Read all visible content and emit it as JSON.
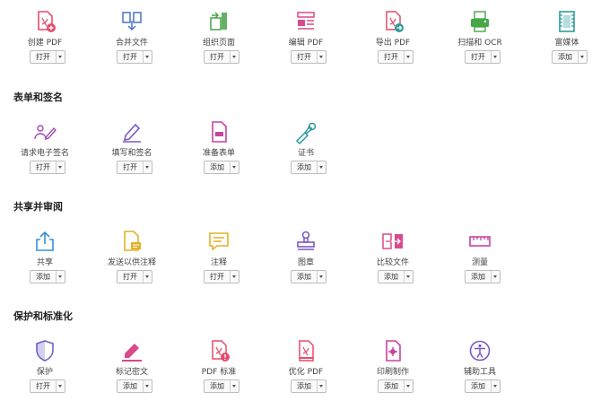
{
  "sections": {
    "forms_signatures": "表单和签名",
    "share_review": "共享并审阅",
    "protect_standardize": "保护和标准化"
  },
  "tools": {
    "create_pdf": {
      "label": "创建 PDF",
      "action": "打开",
      "color": "#e44d6a"
    },
    "combine_files": {
      "label": "合并文件",
      "action": "打开",
      "color": "#4a73c7"
    },
    "organize_pages": {
      "label": "组织页面",
      "action": "打开",
      "color": "#49a34a"
    },
    "edit_pdf": {
      "label": "编辑 PDF",
      "action": "打开",
      "color": "#d94a8c"
    },
    "export_pdf": {
      "label": "导出 PDF",
      "action": "打开",
      "color": "#2e9b9b"
    },
    "scan_ocr": {
      "label": "扫描和 OCR",
      "action": "打开",
      "color": "#45a845"
    },
    "rich_media": {
      "label": "富媒体",
      "action": "添加",
      "color": "#2e9b9b"
    },
    "request_signatures": {
      "label": "请求电子签名",
      "action": "打开",
      "color": "#a24db3"
    },
    "fill_sign": {
      "label": "填写和签名",
      "action": "打开",
      "color": "#7c58c4"
    },
    "prepare_form": {
      "label": "准备表单",
      "action": "添加",
      "color": "#c843a0"
    },
    "certificates": {
      "label": "证书",
      "action": "添加",
      "color": "#2e9b9b"
    },
    "share": {
      "label": "共享",
      "action": "添加",
      "color": "#3a8fd6"
    },
    "send_comments": {
      "label": "发送以供注释",
      "action": "打开",
      "color": "#e2b12a"
    },
    "comment": {
      "label": "注释",
      "action": "打开",
      "color": "#e2b12a"
    },
    "stamp": {
      "label": "图章",
      "action": "添加",
      "color": "#7c58c4"
    },
    "compare_files": {
      "label": "比较文件",
      "action": "添加",
      "color": "#d94a8c"
    },
    "measure": {
      "label": "测量",
      "action": "添加",
      "color": "#c843a0"
    },
    "protect": {
      "label": "保护",
      "action": "打开",
      "color": "#6a62c9"
    },
    "redact": {
      "label": "标记密文",
      "action": "添加",
      "color": "#d94a8c"
    },
    "pdf_standards": {
      "label": "PDF 标准",
      "action": "添加",
      "color": "#e44d6a"
    },
    "optimize_pdf": {
      "label": "优化 PDF",
      "action": "添加",
      "color": "#e44d6a"
    },
    "print_production": {
      "label": "印刷制作",
      "action": "添加",
      "color": "#c843a0"
    },
    "accessibility": {
      "label": "辅助工具",
      "action": "添加",
      "color": "#7c58c4"
    }
  }
}
